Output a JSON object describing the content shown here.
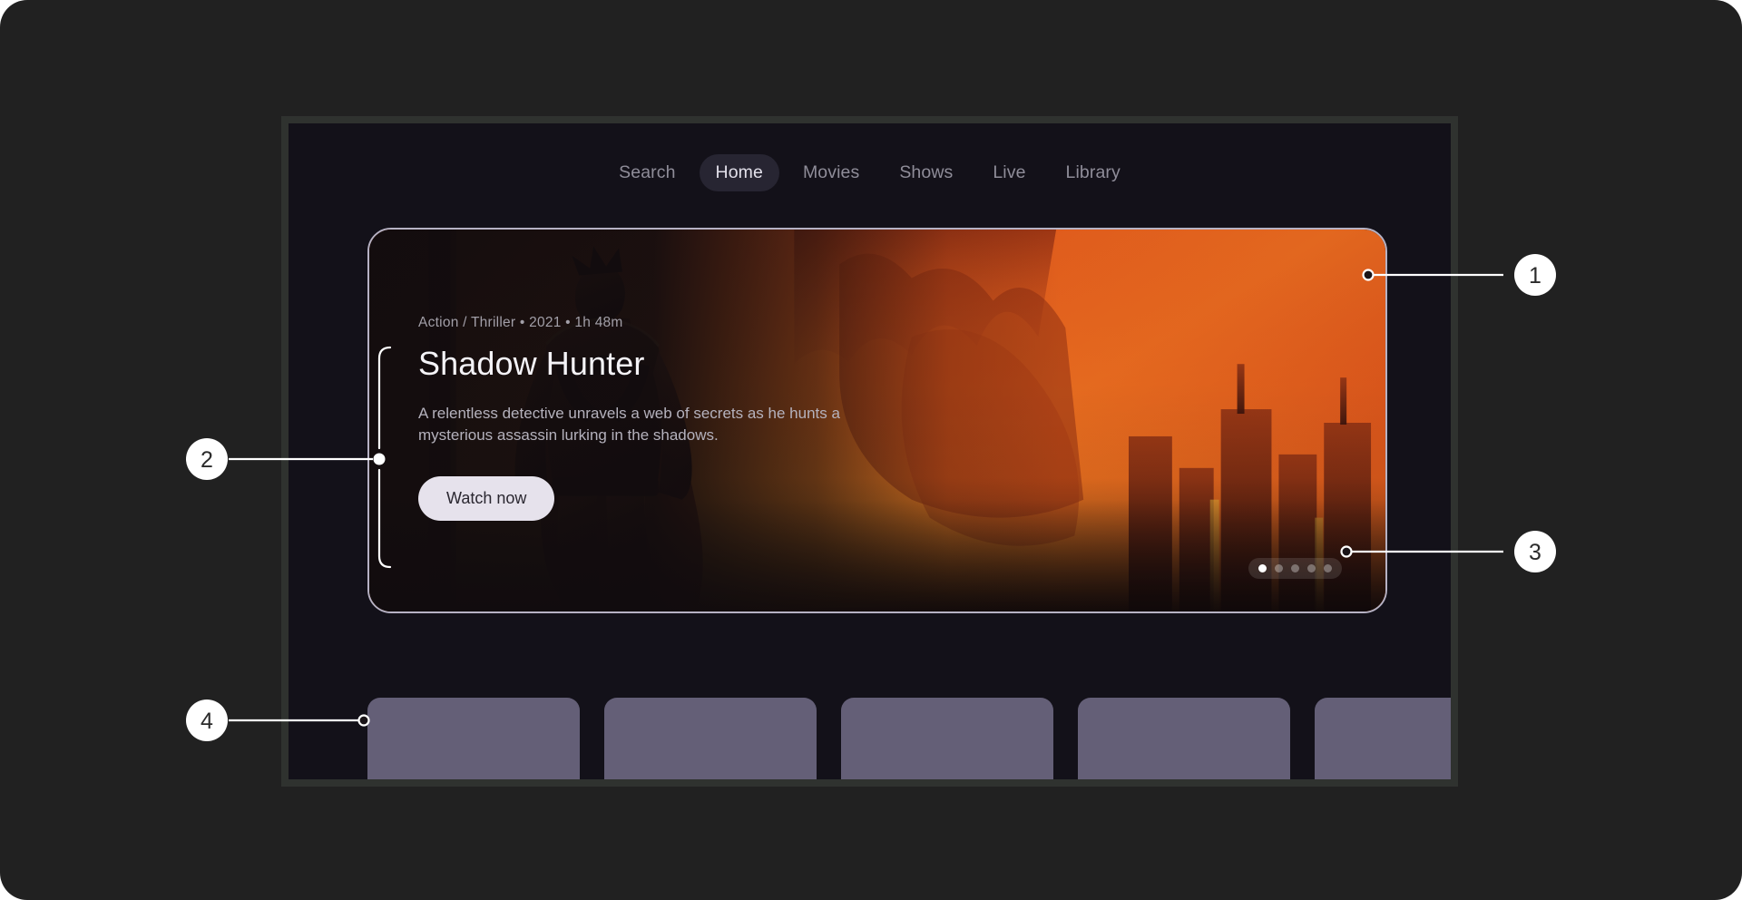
{
  "app": {
    "device_frame": "tv-frame",
    "screen_bg": "#131119"
  },
  "nav": {
    "items": [
      {
        "label": "Search",
        "active": false
      },
      {
        "label": "Home",
        "active": true
      },
      {
        "label": "Movies",
        "active": false
      },
      {
        "label": "Shows",
        "active": false
      },
      {
        "label": "Live",
        "active": false
      },
      {
        "label": "Library",
        "active": false
      }
    ]
  },
  "hero": {
    "meta": "Action / Thriller • 2021 • 1h 48m",
    "title": "Shadow Hunter",
    "description": "A relentless detective unravels a web of secrets as he hunts a mysterious assassin lurking in the shadows.",
    "cta_label": "Watch now",
    "artwork_alt": "Masked superhero standing before a burning orange city skyline",
    "accent_colors": {
      "border": "#b6b2c4",
      "cta_bg": "#e6e2ec",
      "cta_text": "#2a2730",
      "art_warm": "#e0531d",
      "art_hot": "#f2a62a"
    },
    "carousel": {
      "total": 5,
      "active_index": 0
    }
  },
  "rail": {
    "thumb_color": "#645f77",
    "thumbs": [
      {
        "id": "thumb-1"
      },
      {
        "id": "thumb-2"
      },
      {
        "id": "thumb-3"
      },
      {
        "id": "thumb-4"
      },
      {
        "id": "thumb-5"
      }
    ]
  },
  "annotations": [
    {
      "number": "1",
      "target": "hero-card-border",
      "anchor": "ring"
    },
    {
      "number": "2",
      "target": "hero-text-block",
      "anchor": "bracket"
    },
    {
      "number": "3",
      "target": "carousel-dots",
      "anchor": "ring"
    },
    {
      "number": "4",
      "target": "thumbnail-rail",
      "anchor": "ring"
    }
  ]
}
